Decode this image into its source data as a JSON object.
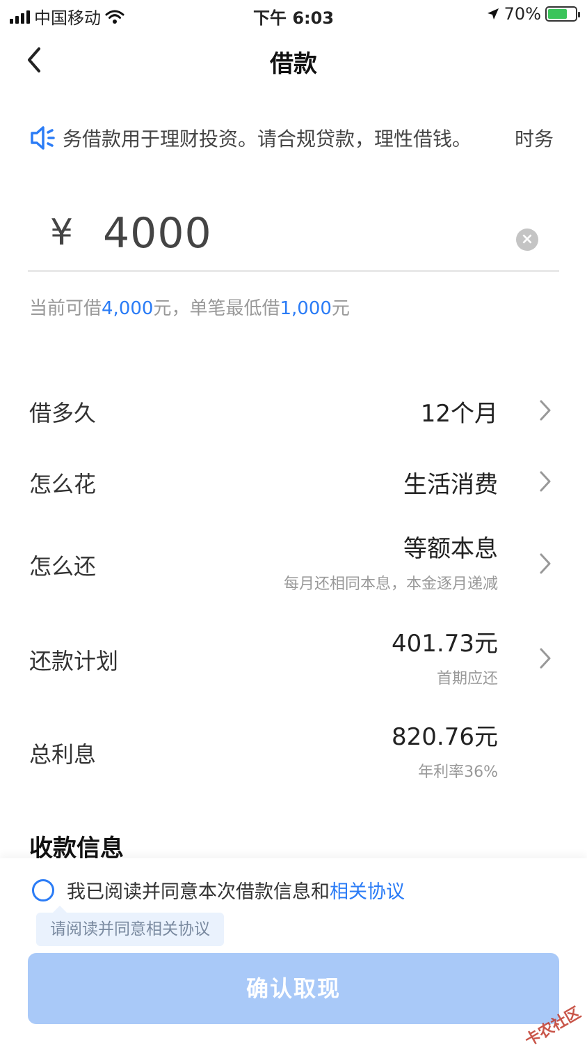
{
  "status_bar": {
    "carrier": "中国移动",
    "time": "下午 6:03",
    "battery": "70%",
    "battery_level": 0.7
  },
  "nav": {
    "title": "借款",
    "back_icon": "chevron-left-icon"
  },
  "notice": {
    "icon": "speaker-icon",
    "text": "务借款用于理财投资。请合规贷款，理性借钱。",
    "tail": "时务"
  },
  "amount": {
    "currency": "¥",
    "value": "4000",
    "clear_icon": "clear-icon"
  },
  "limit": {
    "prefix": "当前可借",
    "available": "4,000",
    "mid": "元，单笔最低借",
    "minimum": "1,000",
    "suffix": "元"
  },
  "rows": {
    "duration": {
      "label": "借多久",
      "value": "12个月"
    },
    "purpose": {
      "label": "怎么花",
      "value": "生活消费"
    },
    "repay_method": {
      "label": "怎么还",
      "value": "等额本息",
      "sub": "每月还相同本息，本金逐月递减"
    },
    "plan": {
      "label": "还款计划",
      "value": "401.73元",
      "sub": "首期应还"
    },
    "interest": {
      "label": "总利息",
      "value": "820.76元",
      "sub": "年利率36%"
    }
  },
  "section_title": "收款信息",
  "agreement": {
    "text": "我已阅读并同意本次借款信息和",
    "link": "相关协议",
    "tip": "请阅读并同意相关协议"
  },
  "confirm_button": "确认取现",
  "watermark": "卡农社区",
  "colors": {
    "accent": "#2b7cf6",
    "button_disabled": "#a9c9f8"
  }
}
